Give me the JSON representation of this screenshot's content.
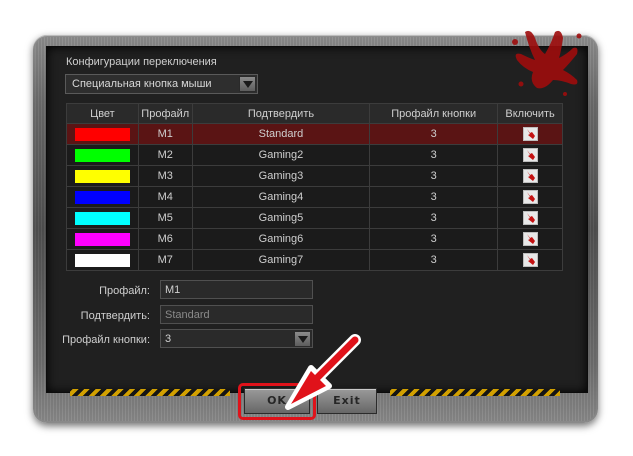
{
  "config": {
    "section_title": "Конфигурации переключения",
    "mode_value": "Специальная кнопка мыши"
  },
  "table": {
    "headers": [
      "Цвет",
      "Профайл",
      "Подтвердить",
      "Профайл кнопки",
      "Включить"
    ],
    "rows": [
      {
        "color": "#ff0000",
        "profile": "M1",
        "confirm": "Standard",
        "button_profile": "3",
        "enabled": true
      },
      {
        "color": "#00ff00",
        "profile": "M2",
        "confirm": "Gaming2",
        "button_profile": "3",
        "enabled": true
      },
      {
        "color": "#ffff00",
        "profile": "M3",
        "confirm": "Gaming3",
        "button_profile": "3",
        "enabled": true
      },
      {
        "color": "#0000ff",
        "profile": "M4",
        "confirm": "Gaming4",
        "button_profile": "3",
        "enabled": true
      },
      {
        "color": "#00ffff",
        "profile": "M5",
        "confirm": "Gaming5",
        "button_profile": "3",
        "enabled": true
      },
      {
        "color": "#ff00ff",
        "profile": "M6",
        "confirm": "Gaming6",
        "button_profile": "3",
        "enabled": true
      },
      {
        "color": "#ffffff",
        "profile": "M7",
        "confirm": "Gaming7",
        "button_profile": "3",
        "enabled": true
      }
    ],
    "selected_row": 0
  },
  "form": {
    "profile_label": "Профайл:",
    "profile_value": "M1",
    "confirm_label": "Подтвердить:",
    "confirm_value": "Standard",
    "button_profile_label": "Профайл кнопки:",
    "button_profile_value": "3"
  },
  "buttons": {
    "ok": "OK",
    "exit": "Exit"
  },
  "colors": {
    "highlight": "#e0121a",
    "selected_row": "#5a1414"
  }
}
